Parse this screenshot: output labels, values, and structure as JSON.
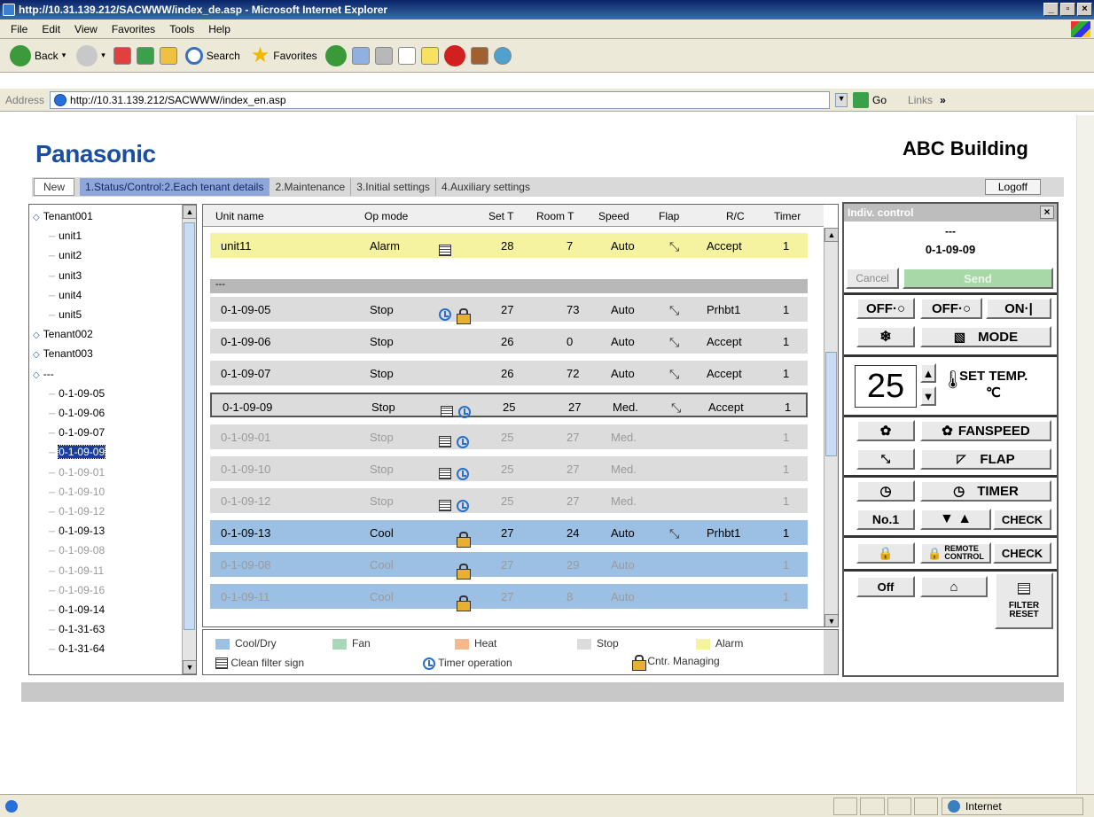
{
  "window": {
    "title": "http://10.31.139.212/SACWWW/index_de.asp - Microsoft Internet Explorer",
    "min": "_",
    "max": "▫",
    "close": "×"
  },
  "menu": [
    "File",
    "Edit",
    "View",
    "Favorites",
    "Tools",
    "Help"
  ],
  "toolbar": {
    "back": "Back",
    "search": "Search",
    "favorites": "Favorites"
  },
  "address": {
    "label": "Address",
    "url": "http://10.31.139.212/SACWWW/index_en.asp",
    "go": "Go",
    "links": "Links"
  },
  "page": {
    "brand": "Panasonic",
    "building": "ABC Building"
  },
  "tabs": {
    "new": "New",
    "items": [
      "1.Status/Control:2.Each tenant details",
      "2.Maintenance",
      "3.Initial settings",
      "4.Auxiliary settings"
    ],
    "logoff": "Logoff"
  },
  "tree": [
    {
      "label": "Tenant001",
      "level": 0,
      "dim": false
    },
    {
      "label": "unit1",
      "level": 1,
      "dim": false
    },
    {
      "label": "unit2",
      "level": 1,
      "dim": false
    },
    {
      "label": "unit3",
      "level": 1,
      "dim": false
    },
    {
      "label": "unit4",
      "level": 1,
      "dim": false
    },
    {
      "label": "unit5",
      "level": 1,
      "dim": false
    },
    {
      "label": "Tenant002",
      "level": 0,
      "dim": false
    },
    {
      "label": "Tenant003",
      "level": 0,
      "dim": false
    },
    {
      "label": "---",
      "level": 0,
      "dim": false
    },
    {
      "label": "0-1-09-05",
      "level": 1,
      "dim": false
    },
    {
      "label": "0-1-09-06",
      "level": 1,
      "dim": false
    },
    {
      "label": "0-1-09-07",
      "level": 1,
      "dim": false
    },
    {
      "label": "0-1-09-09",
      "level": 1,
      "dim": false,
      "selected": true
    },
    {
      "label": "0-1-09-01",
      "level": 1,
      "dim": true
    },
    {
      "label": "0-1-09-10",
      "level": 1,
      "dim": true
    },
    {
      "label": "0-1-09-12",
      "level": 1,
      "dim": true
    },
    {
      "label": "0-1-09-13",
      "level": 1,
      "dim": false
    },
    {
      "label": "0-1-09-08",
      "level": 1,
      "dim": true
    },
    {
      "label": "0-1-09-11",
      "level": 1,
      "dim": true
    },
    {
      "label": "0-1-09-16",
      "level": 1,
      "dim": true
    },
    {
      "label": "0-1-09-14",
      "level": 1,
      "dim": false
    },
    {
      "label": "0-1-31-63",
      "level": 1,
      "dim": false
    },
    {
      "label": "0-1-31-64",
      "level": 1,
      "dim": false
    }
  ],
  "grid": {
    "headers": [
      "Unit name",
      "Op mode",
      "Set T",
      "Room T",
      "Speed",
      "Flap",
      "R/C",
      "Timer"
    ],
    "group": "---",
    "rows": [
      {
        "name": "unit11",
        "mode": "Alarm",
        "set": "28",
        "room": "7",
        "speed": "Auto",
        "flap": true,
        "rc": "Accept",
        "timer": "1",
        "color": "al",
        "icons": [
          "filter"
        ]
      },
      {
        "name": "0-1-09-05",
        "mode": "Stop",
        "set": "27",
        "room": "73",
        "speed": "Auto",
        "flap": true,
        "rc": "Prhbt1",
        "timer": "1",
        "color": "st",
        "icons": [
          "timer",
          "lock"
        ]
      },
      {
        "name": "0-1-09-06",
        "mode": "Stop",
        "set": "26",
        "room": "0",
        "speed": "Auto",
        "flap": true,
        "rc": "Accept",
        "timer": "1",
        "color": "st",
        "icons": []
      },
      {
        "name": "0-1-09-07",
        "mode": "Stop",
        "set": "26",
        "room": "72",
        "speed": "Auto",
        "flap": true,
        "rc": "Accept",
        "timer": "1",
        "color": "st",
        "icons": []
      },
      {
        "name": "0-1-09-09",
        "mode": "Stop",
        "set": "25",
        "room": "27",
        "speed": "Med.",
        "flap": true,
        "rc": "Accept",
        "timer": "1",
        "color": "st",
        "icons": [
          "filter",
          "timer"
        ],
        "selected": true
      },
      {
        "name": "0-1-09-01",
        "mode": "Stop",
        "set": "25",
        "room": "27",
        "speed": "Med.",
        "flap": false,
        "rc": "",
        "timer": "1",
        "color": "st",
        "icons": [
          "filter",
          "timer"
        ],
        "dim": true
      },
      {
        "name": "0-1-09-10",
        "mode": "Stop",
        "set": "25",
        "room": "27",
        "speed": "Med.",
        "flap": false,
        "rc": "",
        "timer": "1",
        "color": "st",
        "icons": [
          "filter",
          "timer"
        ],
        "dim": true
      },
      {
        "name": "0-1-09-12",
        "mode": "Stop",
        "set": "25",
        "room": "27",
        "speed": "Med.",
        "flap": false,
        "rc": "",
        "timer": "1",
        "color": "st",
        "icons": [
          "filter",
          "timer"
        ],
        "dim": true
      },
      {
        "name": "0-1-09-13",
        "mode": "Cool",
        "set": "27",
        "room": "24",
        "speed": "Auto",
        "flap": true,
        "rc": "Prhbt1",
        "timer": "1",
        "color": "cl",
        "icons": [
          "lock"
        ]
      },
      {
        "name": "0-1-09-08",
        "mode": "Cool",
        "set": "27",
        "room": "29",
        "speed": "Auto",
        "flap": false,
        "rc": "",
        "timer": "1",
        "color": "cl",
        "icons": [
          "lock"
        ],
        "dim": true
      },
      {
        "name": "0-1-09-11",
        "mode": "Cool",
        "set": "27",
        "room": "8",
        "speed": "Auto",
        "flap": false,
        "rc": "",
        "timer": "1",
        "color": "cl",
        "icons": [
          "lock"
        ],
        "dim": true
      }
    ]
  },
  "legend": {
    "cool": "Cool/Dry",
    "fan": "Fan",
    "heat": "Heat",
    "stop": "Stop",
    "alarm": "Alarm",
    "filter": "Clean filter sign",
    "timer": "Timer operation",
    "managing": "Cntr. Managing"
  },
  "colors": {
    "cool": "#9cc0e4",
    "fan": "#a8d8b8",
    "heat": "#f5b88c",
    "stop": "#dcdcdc",
    "alarm": "#f5f2a0"
  },
  "indiv": {
    "title": "Indiv. control",
    "close": "×",
    "dash": "---",
    "unit": "0-1-09-09",
    "cancel": "Cancel",
    "send": "Send",
    "off1": "OFF·○",
    "off2": "OFF·○",
    "on": "ON·|",
    "mode": "MODE",
    "temp": "25",
    "set_temp": "SET TEMP.",
    "deg": "℃",
    "fanspeed": "FANSPEED",
    "flap": "FLAP",
    "timer": "TIMER",
    "no": "No.1",
    "check": "CHECK",
    "remote1": "REMOTE",
    "remote2": "CONTROL",
    "check2": "CHECK",
    "off3": "Off",
    "filter1": "FILTER",
    "filter2": "RESET"
  },
  "status": {
    "zone": "Internet"
  }
}
